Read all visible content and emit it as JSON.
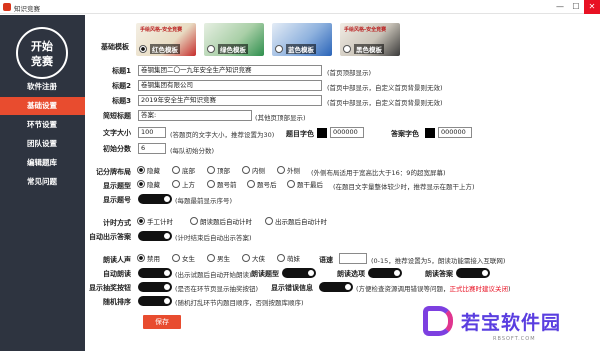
{
  "window": {
    "title": "知识竞赛",
    "minimize": "—",
    "maximize": "☐",
    "close": "✕"
  },
  "sidebar": {
    "logo_line1": "开始",
    "logo_line2": "竞赛",
    "items": [
      {
        "label": "软件注册"
      },
      {
        "label": "基础设置"
      },
      {
        "label": "环节设置"
      },
      {
        "label": "团队设置"
      },
      {
        "label": "编辑题库"
      },
      {
        "label": "常见问题"
      }
    ]
  },
  "templates": {
    "label": "基础模板",
    "items": [
      {
        "label": "红色模板",
        "thumb_title": "手绘风格-安全竞赛",
        "selected": true,
        "color": "#c62c2c"
      },
      {
        "label": "绿色模板",
        "thumb_title": "",
        "selected": false,
        "color": "#2f8f4e"
      },
      {
        "label": "蓝色模板",
        "thumb_title": "",
        "selected": false,
        "color": "#2a64b8"
      },
      {
        "label": "黑色模板",
        "thumb_title": "手绘风格-安全竞赛",
        "selected": false,
        "color": "#3a3a3a"
      }
    ]
  },
  "titles": {
    "title1_label": "标题1",
    "title1_value": "卷钢集团二〇一九年安全生产知识竞赛",
    "title1_hint": "(首页顶部显示)",
    "title2_label": "标题2",
    "title2_value": "卷钢集团有限公司",
    "title2_hint": "(首页中部显示，自定义首页背景则无效)",
    "title3_label": "标题3",
    "title3_value": "2019年安全生产知识竞赛",
    "title3_hint": "(首页中部显示，自定义首页背景则无效)",
    "tail_label": "简短标题",
    "tail_value": "答案:",
    "tail_hint": "(其他页顶部显示)"
  },
  "text_settings": {
    "size_label": "文字大小",
    "size_value": "100",
    "size_hint": "(答题页的文字大小，推荐设置为30)",
    "title_color_label": "题目字色",
    "title_color_value": "000000",
    "answer_color_label": "答案字色",
    "answer_color_value": "000000",
    "score_label": "初始分数",
    "score_value": "6",
    "score_hint": "(每队初始分数)"
  },
  "scoreboard": {
    "label": "记分牌布局",
    "options": [
      {
        "label": "隐藏",
        "selected": true
      },
      {
        "label": "底部",
        "selected": false
      },
      {
        "label": "顶部",
        "selected": false
      },
      {
        "label": "内侧",
        "selected": false
      },
      {
        "label": "外侧",
        "selected": false
      }
    ],
    "hint": "(外侧布局适用于宽高比大于16：9的超宽屏幕)"
  },
  "question_type": {
    "label": "显示题型",
    "options": [
      {
        "label": "隐藏",
        "selected": true
      },
      {
        "label": "上方",
        "selected": false
      },
      {
        "label": "题号前",
        "selected": false
      },
      {
        "label": "题号后",
        "selected": false
      },
      {
        "label": "题干最后",
        "selected": false
      }
    ],
    "hint": "(在题目文字量整体较少时，推荐显示在题干上方)"
  },
  "question_number": {
    "label": "显示题号",
    "hint": "(每题最前显示序号)"
  },
  "timing": {
    "label": "计时方式",
    "options": [
      {
        "label": "手工计时",
        "selected": true
      },
      {
        "label": "朗读题后自动计时",
        "selected": false
      },
      {
        "label": "出示题后自动计时",
        "selected": false
      }
    ]
  },
  "auto_answer": {
    "label": "自动出示答案",
    "hint": "(计时结束后自动出示答案)"
  },
  "voice": {
    "label": "朗读人声",
    "options": [
      {
        "label": "禁用",
        "selected": true
      },
      {
        "label": "女生",
        "selected": false
      },
      {
        "label": "男生",
        "selected": false
      },
      {
        "label": "大侠",
        "selected": false
      },
      {
        "label": "萌妹",
        "selected": false
      }
    ],
    "speed_label": "语速",
    "speed_value": "",
    "speed_hint": "(0-15，推荐设置为5，朗读功能需接入互联网)"
  },
  "auto_read": {
    "label": "自动朗读",
    "hint": "(出示试题后自动开始朗读)",
    "type_label": "朗读题型",
    "options_label": "朗读选项",
    "answer_label": "朗读答案"
  },
  "misc": {
    "robber_label": "显示抽奖按钮",
    "robber_hint": "(是否在环节页显示抽奖按钮)",
    "error_label": "显示错误信息",
    "error_hint": "(方便检查资源调用错误等问题，",
    "error_hint_red": "正式比赛时建议关闭",
    "error_hint_end": ")",
    "random_label": "随机排序",
    "random_hint": "(随机打乱环节内题目顺序，否则按题库顺序)"
  },
  "save_label": "保存",
  "watermark": {
    "text": "若宝软件园",
    "sub": "RBSOFT.COM"
  }
}
